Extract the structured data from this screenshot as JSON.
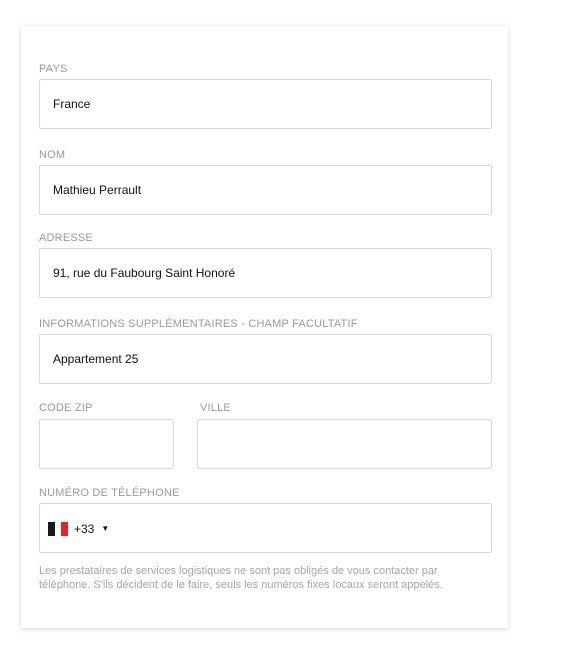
{
  "form": {
    "country": {
      "label": "PAYS",
      "value": "France"
    },
    "name": {
      "label": "NOM",
      "value": "Mathieu Perrault"
    },
    "address": {
      "label": "ADRESSE",
      "value": "91, rue du Faubourg Saint Honoré"
    },
    "extra": {
      "label": "INFORMATIONS SUPPLÉMENTAIRES - CHAMP FACULTATIF",
      "value": "Appartement 25"
    },
    "zip": {
      "label": "CODE ZIP",
      "value": ""
    },
    "city": {
      "label": "VILLE",
      "value": ""
    },
    "phone": {
      "label": "NUMÉRO DE TÉLÉPHONE",
      "country_code": "+33",
      "flag_icon": "france-flag-icon",
      "flag_colors": [
        "#1a1a1a",
        "#ffffff",
        "#e0252d"
      ],
      "value": ""
    },
    "note": "Les prestataires de services logistiques ne sont pas obligés de vous contacter par téléphone. S'ils décident de le faire, seuls les numéros fixes locaux seront appelés."
  }
}
